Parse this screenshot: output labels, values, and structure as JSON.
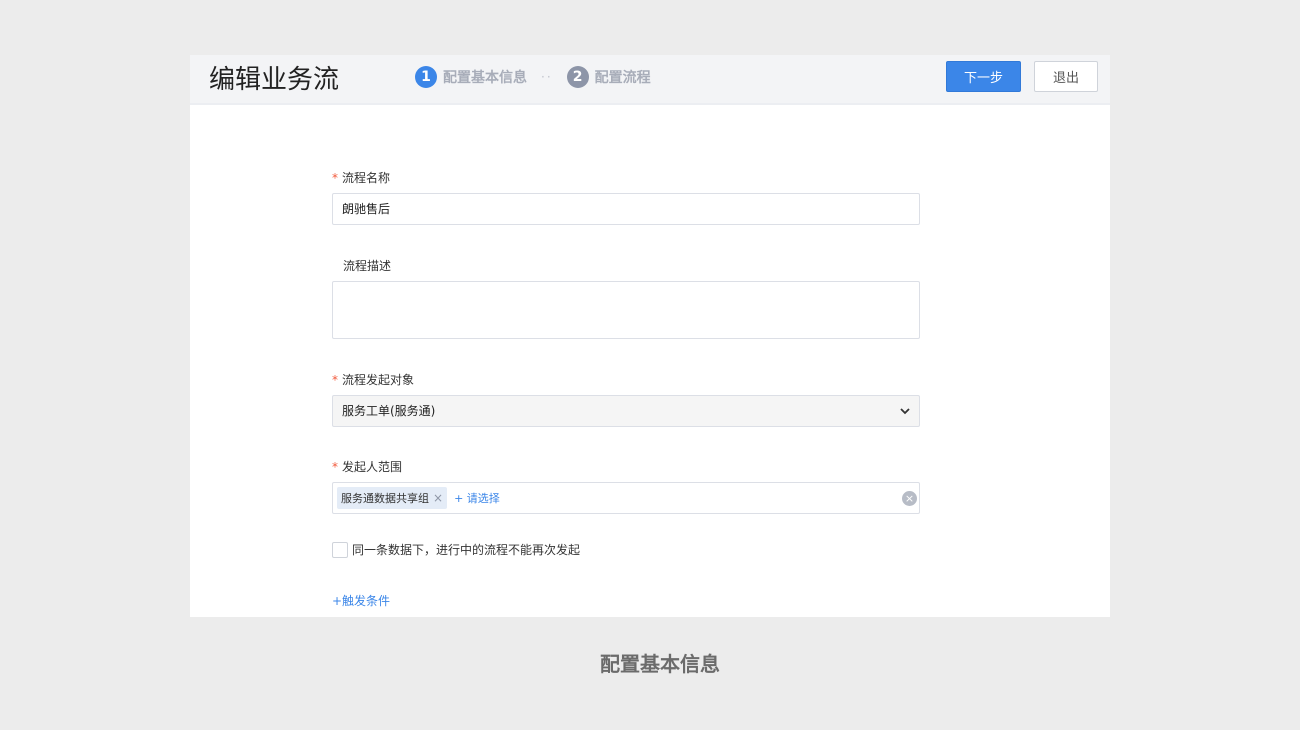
{
  "header": {
    "title": "编辑业务流",
    "steps": [
      {
        "num": "1",
        "label": "配置基本信息"
      },
      {
        "num": "2",
        "label": "配置流程"
      }
    ],
    "step_separator": "··",
    "next_label": "下一步",
    "exit_label": "退出"
  },
  "form": {
    "name": {
      "required_mark": "*",
      "label": "流程名称",
      "value": "朗驰售后"
    },
    "description": {
      "label": "流程描述",
      "value": ""
    },
    "target": {
      "required_mark": "*",
      "label": "流程发起对象",
      "value": "服务工单(服务通)"
    },
    "scope": {
      "required_mark": "*",
      "label": "发起人范围",
      "tags": [
        "服务通数据共享组"
      ],
      "add_label": "+ 请选择"
    },
    "no_repeat": {
      "label": "同一条数据下，进行中的流程不能再次发起",
      "checked": false
    },
    "trigger_link": "+触发条件"
  },
  "caption": "配置基本信息",
  "colors": {
    "accent": "#3b86e8",
    "required": "#f25a3c"
  }
}
